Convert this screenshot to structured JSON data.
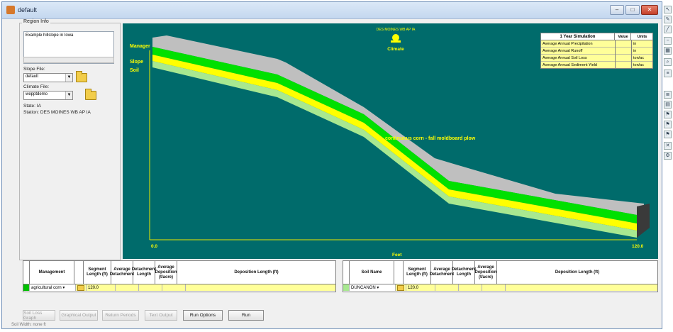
{
  "window": {
    "title": "default"
  },
  "region": {
    "legend": "Region Info",
    "notes": "Example hillslope in Iowa",
    "slope_label": "Slope File:",
    "slope_value": "default",
    "climate_label": "Climate File:",
    "climate_value": "wepptdemo",
    "state": "State: IA",
    "station": "Station: DES MOINES WB AP IA"
  },
  "plot": {
    "station_title": "DES MOINES WB AP IA",
    "climate_label": "Climate",
    "layers": [
      "Manager",
      "Slope",
      "Soil"
    ],
    "management_annotation": "continuous corn - fall moldboard plow",
    "x_start": "0.0",
    "x_end": "120.0",
    "x_label": "Feet"
  },
  "summary": {
    "header": "1 Year Simulation",
    "value_header": "Value",
    "units_header": "Units",
    "rows": [
      {
        "label": "Average Annual Precipitation",
        "value": "",
        "units": "in"
      },
      {
        "label": "Average Annual Runoff",
        "value": "",
        "units": "in"
      },
      {
        "label": "Average Annual Soil Loss",
        "value": "",
        "units": "ton/ac"
      },
      {
        "label": "Average Annual Sediment Yield",
        "value": "",
        "units": "ton/ac"
      }
    ]
  },
  "mgmt_table": {
    "headers": [
      "Management",
      "Segment Length (ft)",
      "Average Detachment",
      "Detachment Length",
      "Average Deposition (t/acre)",
      "Deposition Length (ft)"
    ],
    "row": {
      "name": "agricultural corn",
      "length": "120.0"
    }
  },
  "soil_table": {
    "headers": [
      "Soil Name",
      "Segment Length (ft)",
      "Average Detachment",
      "Detachment Length",
      "Average Deposition (t/acre)",
      "Deposition Length (ft)"
    ],
    "row": {
      "name": "DUNCANON",
      "length": "120.0"
    }
  },
  "buttons": {
    "soil_loss_graph": "Soil Loss Graph",
    "graphical_output": "Graphical Output",
    "return_periods": "Return Periods",
    "text_output": "Text Output",
    "run_options": "Run Options",
    "run": "Run"
  },
  "status": "Soil Width: none ft",
  "colors": {
    "plot_bg": "#006b6b",
    "management_layer": "#bfbfbf",
    "green_layer": "#00e000",
    "yellow_layer": "#ffff00",
    "soil_layer": "#a8e890",
    "accent_text": "#ffff00"
  }
}
